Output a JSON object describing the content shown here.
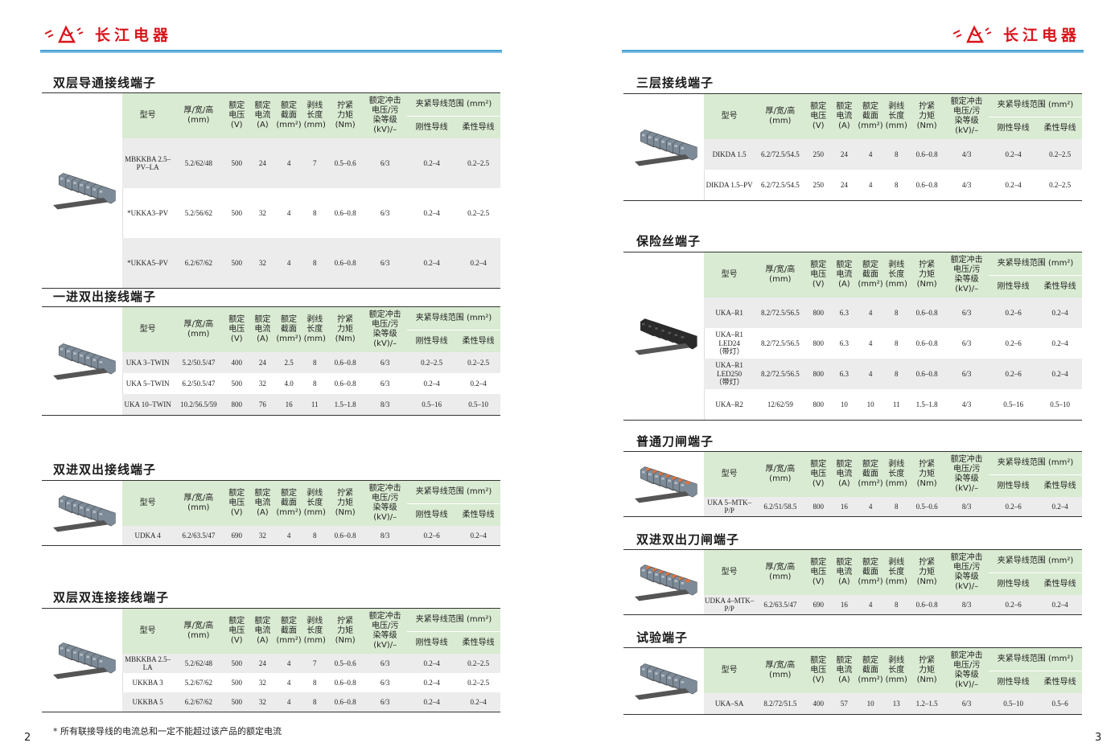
{
  "brand": {
    "name": "长江电器"
  },
  "headers": {
    "model": "型号",
    "dims": "厚/宽/高\n(mm)",
    "voltage": "额定\n电压\n(V)",
    "current": "额定\n电流\n(A)",
    "section": "额定\n截面\n(mm²)",
    "strip": "剥线\n长度\n(mm)",
    "torque": "拧紧\n力矩\n(Nm)",
    "impulse": "额定冲击\n电压/污\n染等级\n(kV)/–",
    "clamp": "夹紧导线范围 (mm²)",
    "rigid": "刚性导线",
    "flex": "柔性导线"
  },
  "left_sections": [
    {
      "title": "双层导通接线端子",
      "rows": [
        [
          "MBKKBA 2.5–PV–LA",
          "5.2/62/48",
          "500",
          "24",
          "4",
          "7",
          "0.5–0.6",
          "6/3",
          "0.2–4",
          "0.2–2.5"
        ],
        [
          "*UKKA3–PV",
          "5.2/56/62",
          "500",
          "32",
          "4",
          "8",
          "0.6–0.8",
          "6/3",
          "0.2–4",
          "0.2–2.5"
        ],
        [
          "*UKKA5–PV",
          "6.2/67/62",
          "500",
          "32",
          "4",
          "8",
          "0.6–0.8",
          "6/3",
          "0.2–4",
          "0.2–4"
        ]
      ]
    },
    {
      "title": "一进双出接线端子",
      "rows": [
        [
          "UKA 3–TWIN",
          "5.2/50.5/47",
          "400",
          "24",
          "2.5",
          "8",
          "0.6–0.8",
          "6/3",
          "0.2–2.5",
          "0.2–2.5"
        ],
        [
          "UKA 5–TWIN",
          "6.2/50.5/47",
          "500",
          "32",
          "4.0",
          "8",
          "0.6–0.8",
          "6/3",
          "0.2–4",
          "0.2–4"
        ],
        [
          "UKA 10–TWIN",
          "10.2/56.5/59",
          "800",
          "76",
          "16",
          "11",
          "1.5–1.8",
          "8/3",
          "0.5–16",
          "0.5–10"
        ]
      ]
    },
    {
      "title": "双进双出接线端子",
      "rows": [
        [
          "UDKA 4",
          "6.2/63.5/47",
          "690",
          "32",
          "4",
          "8",
          "0.6–0.8",
          "8/3",
          "0.2–6",
          "0.2–4"
        ]
      ]
    },
    {
      "title": "双层双连接接线端子",
      "rows": [
        [
          "MBKKBA 2.5–LA",
          "5.2/62/48",
          "500",
          "24",
          "4",
          "7",
          "0.5–0.6",
          "6/3",
          "0.2–4",
          "0.2–2.5"
        ],
        [
          "UKKBA 3",
          "5.2/67/62",
          "500",
          "32",
          "4",
          "8",
          "0.6–0.8",
          "6/3",
          "0.2–4",
          "0.2–2.5"
        ],
        [
          "UKKBA 5",
          "6.2/67/62",
          "500",
          "32",
          "4",
          "8",
          "0.6–0.8",
          "6/3",
          "0.2–4",
          "0.2–4"
        ]
      ]
    }
  ],
  "right_sections": [
    {
      "title": "三层接线端子",
      "rows": [
        [
          "DIKDA 1.5",
          "6.2/72.5/54.5",
          "250",
          "24",
          "4",
          "8",
          "0.6–0.8",
          "4/3",
          "0.2–4",
          "0.2–2.5"
        ],
        [
          "DIKDA 1.5–PV",
          "6.2/72.5/54.5",
          "250",
          "24",
          "4",
          "8",
          "0.6–0.8",
          "4/3",
          "0.2–4",
          "0.2–2.5"
        ]
      ]
    },
    {
      "title": "保险丝端子",
      "rows": [
        [
          "UKA–R1",
          "8.2/72.5/56.5",
          "800",
          "6.3",
          "4",
          "8",
          "0.6–0.8",
          "6/3",
          "0.2–6",
          "0.2–4"
        ],
        [
          "UKA–R1 LED24\n（带灯）",
          "8.2/72.5/56.5",
          "800",
          "6.3",
          "4",
          "8",
          "0.6–0.8",
          "6/3",
          "0.2–6",
          "0.2–4"
        ],
        [
          "UKA–R1 LED250\n（带灯）",
          "8.2/72.5/56.5",
          "800",
          "6.3",
          "4",
          "8",
          "0.6–0.8",
          "6/3",
          "0.2–6",
          "0.2–4"
        ],
        [
          "UKA–R2",
          "12/62/59",
          "800",
          "10",
          "10",
          "11",
          "1.5–1.8",
          "4/3",
          "0.5–16",
          "0.5–10"
        ]
      ]
    },
    {
      "title": "普通刀闸端子",
      "rows": [
        [
          "UKA 5–MTK–P/P",
          "6.2/51/58.5",
          "800",
          "16",
          "4",
          "8",
          "0.5–0.6",
          "8/3",
          "0.2–6",
          "0.2–4"
        ]
      ]
    },
    {
      "title": "双进双出刀闸端子",
      "rows": [
        [
          "UDKA 4–MTK–P/P",
          "6.2/63.5/47",
          "690",
          "16",
          "4",
          "8",
          "0.6–0.8",
          "8/3",
          "0.2–6",
          "0.2–4"
        ]
      ]
    },
    {
      "title": "试验端子",
      "rows": [
        [
          "UKA–SA",
          "8.2/72/51.5",
          "400",
          "57",
          "10",
          "13",
          "1.2–1.5",
          "6/3",
          "0.5–10",
          "0.5–6"
        ]
      ]
    }
  ],
  "footnote": "* 所有联接导线的电流总和一定不能超过该产品的额定电流",
  "page_numbers": {
    "left": "2",
    "right": "3"
  }
}
